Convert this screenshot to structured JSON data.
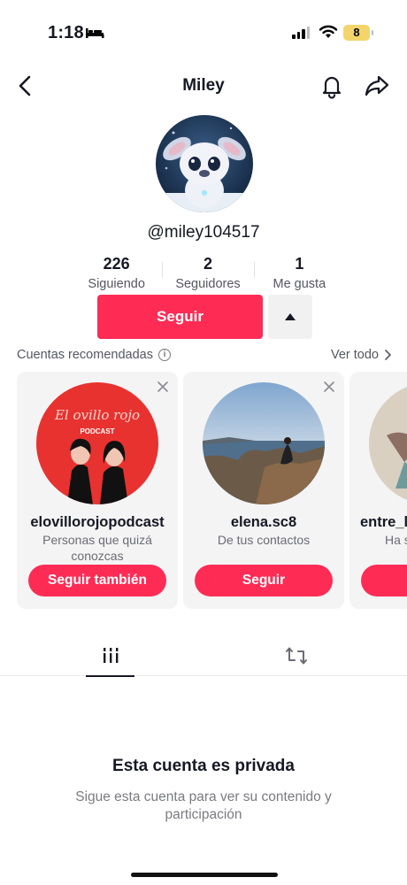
{
  "status_bar": {
    "time": "1:18",
    "battery": "8"
  },
  "header": {
    "title": "Miley"
  },
  "profile": {
    "username": "@miley104517",
    "stats": [
      {
        "value": "226",
        "label": "Siguiendo"
      },
      {
        "value": "2",
        "label": "Seguidores"
      },
      {
        "value": "1",
        "label": "Me gusta"
      }
    ],
    "follow_label": "Seguir"
  },
  "recommended": {
    "title": "Cuentas recomendadas",
    "see_all": "Ver todo",
    "cards": [
      {
        "name": "elovillorojopodcast",
        "reason": "Personas que quizá conozcas",
        "button": "Seguir también",
        "logo_text": "El ovillo rojo",
        "logo_sub": "PODCAST"
      },
      {
        "name": "elena.sc8",
        "reason": "De tus contactos",
        "button": "Seguir"
      },
      {
        "name": "entre_l",
        "reason": "Ha s",
        "button": ""
      }
    ]
  },
  "tabs": {
    "icons": [
      "grid-icon",
      "repost-icon"
    ]
  },
  "private": {
    "title": "Esta cuenta es privada",
    "description": "Sigue esta cuenta para ver su contenido y participación"
  },
  "colors": {
    "accent": "#fe2c55",
    "battery": "#f3d56b"
  }
}
